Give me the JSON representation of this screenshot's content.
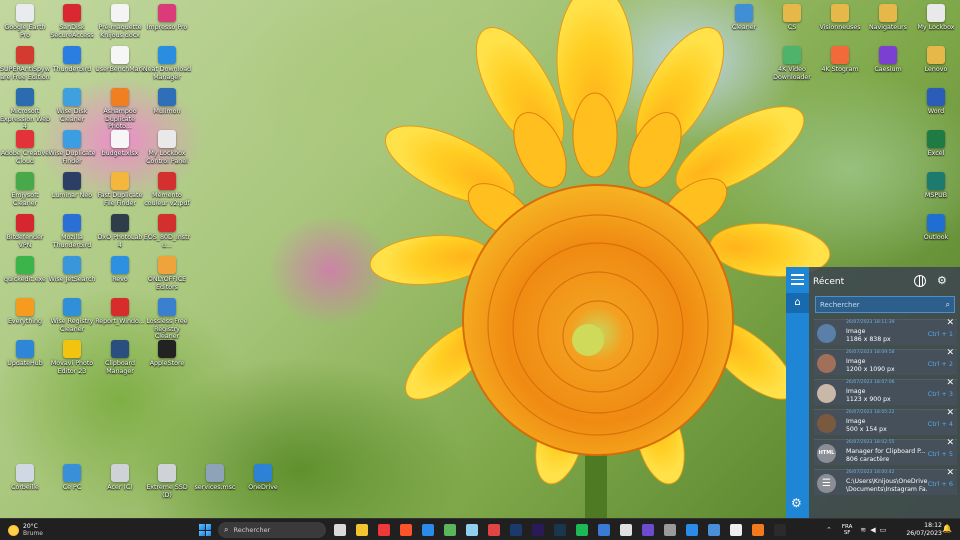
{
  "desktop_icons": [
    {
      "label": "Google Earth Pro",
      "color": "#e9ecef"
    },
    {
      "label": "SUPERAntiSpyware Free Edition",
      "color": "#d33b2f"
    },
    {
      "label": "Microsoft Expression Web 4",
      "color": "#2b6cb0"
    },
    {
      "label": "Adobe Creative Cloud",
      "color": "#e2323a"
    },
    {
      "label": "Emjysoft Cleaner",
      "color": "#48a94b"
    },
    {
      "label": "Bitdefender VPN",
      "color": "#d6262f"
    },
    {
      "label": "quickedit.exe",
      "color": "#3bb54a"
    },
    {
      "label": "Everything",
      "color": "#f59b1f"
    },
    {
      "label": "UpdateHub",
      "color": "#2f86d6"
    },
    {
      "label": "SanDisk SecureAccess",
      "color": "#d9282f"
    },
    {
      "label": "Thunderbird",
      "color": "#2a7de1"
    },
    {
      "label": "Wise Disk Cleaner",
      "color": "#3fa0e0"
    },
    {
      "label": "Wise Duplicate Finder",
      "color": "#3c9ee2"
    },
    {
      "label": "Luminar Neo",
      "color": "#2c3e63"
    },
    {
      "label": "Mozilla Thunderbird",
      "color": "#2a6fd6"
    },
    {
      "label": "Wise JetSearch",
      "color": "#3a96db"
    },
    {
      "label": "Wise Registry Cleaner",
      "color": "#2f8fd9"
    },
    {
      "label": "Movavi Photo Editor 23",
      "color": "#f2c40f"
    },
    {
      "label": "Pré-maquette Knijous.docx",
      "color": "#f4f4f4"
    },
    {
      "label": "UserBenchMark",
      "color": "#f6f6f6"
    },
    {
      "label": "Ashampoo Duplicate Photo...",
      "color": "#f07f22"
    },
    {
      "label": "budget.xlsx",
      "color": "#f6f6f6"
    },
    {
      "label": "Fast Duplicate File Finder",
      "color": "#f4b63b"
    },
    {
      "label": "DxO PhotoLab 4",
      "color": "#2f3d4a"
    },
    {
      "label": "Revo",
      "color": "#2d90e0"
    },
    {
      "label": "Report_Windo...",
      "color": "#d82c2c"
    },
    {
      "label": "Clipboard Manager",
      "color": "#2a4e7e"
    },
    {
      "label": "Impresso Pro",
      "color": "#dc3b7a"
    },
    {
      "label": "Neat Download Manager",
      "color": "#2a8de0"
    },
    {
      "label": "Mulimon",
      "color": "#2f6fb8"
    },
    {
      "label": "My Lockbox Control Panel",
      "color": "#e9e9e9"
    },
    {
      "label": "Mémento couleur v2.pdf",
      "color": "#d3302f"
    },
    {
      "label": "EOS_80D_Instru...",
      "color": "#d22f2f"
    },
    {
      "label": "ONLYOFFICE Editors",
      "color": "#f0a23b"
    },
    {
      "label": "Lossless Free Registry Cleaner",
      "color": "#3a7fd0"
    },
    {
      "label": "AppleStore",
      "color": "#222222"
    },
    {
      "label": "Cleaner",
      "color": "#3f8ed6"
    },
    {
      "label": "CS",
      "color": "#e6b84a"
    },
    {
      "label": "Visionneuses",
      "color": "#e6b84a"
    },
    {
      "label": "Navigateurs",
      "color": "#e6b84a"
    },
    {
      "label": "My Lockbox",
      "color": "#e9e9e9"
    },
    {
      "label": "4K Video Downloader",
      "color": "#4fb36b"
    },
    {
      "label": "4K Stogram",
      "color": "#f26a3a"
    },
    {
      "label": "Caesium",
      "color": "#7b3fd1"
    },
    {
      "label": "Lenovo",
      "color": "#e6b84a"
    },
    {
      "label": "Word",
      "color": "#2b5cb8"
    },
    {
      "label": "Excel",
      "color": "#1f7a44"
    },
    {
      "label": "MSPUB",
      "color": "#1c7a6f"
    },
    {
      "label": "Outlook",
      "color": "#1f6fd0"
    },
    {
      "label": "Corbeille",
      "color": "#cfd8e3"
    },
    {
      "label": "Ce PC",
      "color": "#3a8fd9"
    },
    {
      "label": "Acer (C)",
      "color": "#cfd3d8"
    },
    {
      "label": "Extreme SSD (D)",
      "color": "#cfd3d8"
    },
    {
      "label": "services.msc",
      "color": "#8fa3b8"
    },
    {
      "label": "OneDrive",
      "color": "#2d82d6"
    }
  ],
  "clipboard": {
    "title": "Récent",
    "search_placeholder": "Rechercher",
    "items": [
      {
        "type": "Image",
        "detail": "1186 x 838  px",
        "timestamp": "26/07/2023 18:11:39",
        "shortcut": "Ctrl + 1",
        "thumb": "#5a7fa8"
      },
      {
        "type": "Image",
        "detail": "1200 x 1090  px",
        "timestamp": "26/07/2023 18:09:58",
        "shortcut": "Ctrl + 2",
        "thumb": "#a0705a"
      },
      {
        "type": "Image",
        "detail": "1123 x 900  px",
        "timestamp": "26/07/2023 18:07:06",
        "shortcut": "Ctrl + 3",
        "thumb": "#c9b7a8"
      },
      {
        "type": "Image",
        "detail": "500 x 154  px",
        "timestamp": "26/07/2023 18:05:22",
        "shortcut": "Ctrl + 4",
        "thumb": "#7a5a3e"
      },
      {
        "type": "Manager for Clipboard P...",
        "detail": "806  caractère",
        "timestamp": "26/07/2023 18:02:55",
        "shortcut": "Ctrl + 5",
        "thumb_label": "HTML"
      },
      {
        "type": "C:\\Users\\Knijous\\OneDrive",
        "detail": "\\Documents\\Instagram Fa...",
        "timestamp": "26/07/2023 18:00:42",
        "shortcut": "Ctrl + 6",
        "thumb_label": "☰"
      }
    ]
  },
  "taskbar": {
    "weather_temp": "20°C",
    "weather_desc": "Brume",
    "search_placeholder": "Rechercher",
    "lang_top": "FRA",
    "lang_bottom": "SF",
    "time": "18:12",
    "date": "26/07/2023",
    "apps": [
      {
        "name": "task-view",
        "color": "#d9d9d9"
      },
      {
        "name": "file-explorer",
        "color": "#f4c430"
      },
      {
        "name": "vivaldi",
        "color": "#ef3939"
      },
      {
        "name": "brave",
        "color": "#fb542b"
      },
      {
        "name": "mail",
        "color": "#2a8be8"
      },
      {
        "name": "notepad",
        "color": "#5bb55b"
      },
      {
        "name": "monitor",
        "color": "#8fd0f0"
      },
      {
        "name": "paint",
        "color": "#e04545"
      },
      {
        "name": "photoshop",
        "color": "#1b3a6b"
      },
      {
        "name": "premiere",
        "color": "#2a1a57"
      },
      {
        "name": "lightroom",
        "color": "#1a3550"
      },
      {
        "name": "spotify",
        "color": "#1db954"
      },
      {
        "name": "vlc-like",
        "color": "#3a7bd5"
      },
      {
        "name": "davinci",
        "color": "#e0e0e0"
      },
      {
        "name": "app-purple",
        "color": "#6c4bd1"
      },
      {
        "name": "app-grey",
        "color": "#9a9a9a"
      },
      {
        "name": "app-blue",
        "color": "#2a8be8"
      },
      {
        "name": "photos",
        "color": "#4a90d9"
      },
      {
        "name": "app-white",
        "color": "#eeeeee"
      },
      {
        "name": "media-player",
        "color": "#f27a1d"
      },
      {
        "name": "terminal",
        "color": "#2b2b2b"
      }
    ]
  }
}
